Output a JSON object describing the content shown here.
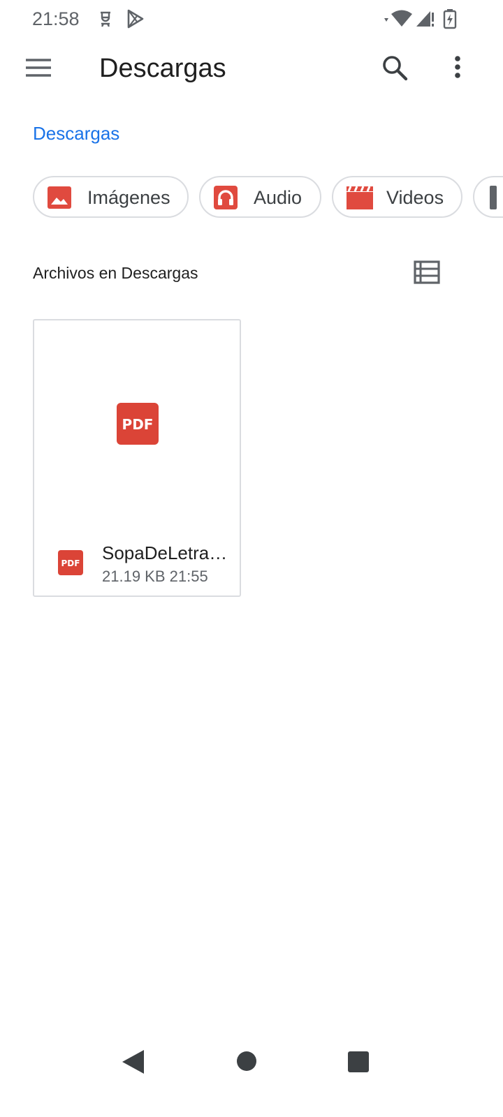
{
  "status_bar": {
    "time": "21:58",
    "icons": [
      "notification-icon",
      "play-store-icon",
      "wifi-icon",
      "signal-icon",
      "battery-charging-icon"
    ]
  },
  "app_bar": {
    "title": "Descargas",
    "menu_icon": "hamburger-menu-icon",
    "search_icon": "search-icon",
    "more_icon": "more-vert-icon"
  },
  "breadcrumb": "Descargas",
  "chips": [
    {
      "label": "Imágenes",
      "icon": "image-icon"
    },
    {
      "label": "Audio",
      "icon": "headphones-icon"
    },
    {
      "label": "Videos",
      "icon": "video-clapper-icon"
    }
  ],
  "section": {
    "title": "Archivos en Descargas",
    "view_toggle_icon": "list-view-icon"
  },
  "files": [
    {
      "name": "SopaDeLetra…",
      "size": "21.19 KB",
      "time": "21:55",
      "type_badge": "PDF"
    }
  ],
  "colors": {
    "accent": "#1a73e8",
    "pdf_red": "#db4437",
    "chip_icon_red": "#e04a3f"
  },
  "nav_bar": [
    "back-icon",
    "home-icon",
    "recents-icon"
  ]
}
